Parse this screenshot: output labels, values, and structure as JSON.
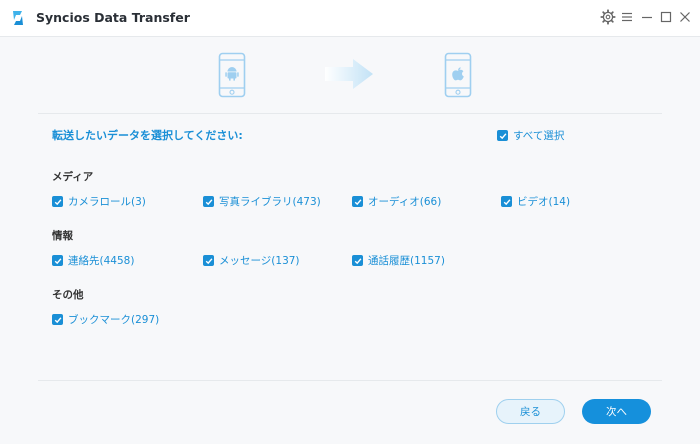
{
  "app": {
    "title": "Syncios Data Transfer"
  },
  "colors": {
    "accent": "#1a8fd6",
    "primary_button": "#1590dc",
    "phone_outline": "#9fcff0"
  },
  "window_controls": [
    "settings-gear-icon",
    "menu-icon",
    "minimize-icon",
    "maximize-icon",
    "close-icon"
  ],
  "devices": {
    "source": "android-phone-icon",
    "target": "apple-phone-icon"
  },
  "prompt": "転送したいデータを選択してください:",
  "select_all": {
    "label": "すべて選択",
    "checked": true
  },
  "sections": [
    {
      "title": "メディア",
      "items": [
        {
          "label": "カメラロール(3)",
          "checked": true
        },
        {
          "label": "写真ライブラリ(473)",
          "checked": true
        },
        {
          "label": "オーディオ(66)",
          "checked": true
        },
        {
          "label": "ビデオ(14)",
          "checked": true
        }
      ]
    },
    {
      "title": "情報",
      "items": [
        {
          "label": "連絡先(4458)",
          "checked": true
        },
        {
          "label": "メッセージ(137)",
          "checked": true
        },
        {
          "label": "通話履歴(1157)",
          "checked": true
        }
      ]
    },
    {
      "title": "その他",
      "items": [
        {
          "label": "ブックマーク(297)",
          "checked": true
        }
      ]
    }
  ],
  "buttons": {
    "back": "戻る",
    "next": "次へ"
  }
}
